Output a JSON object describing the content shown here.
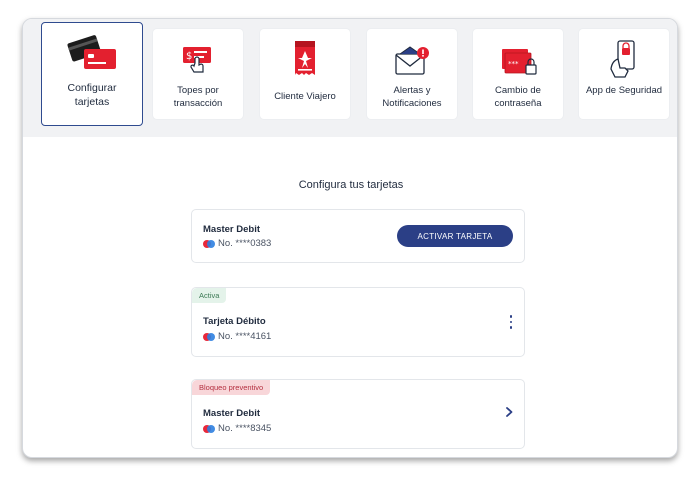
{
  "tiles": [
    {
      "label": "Configurar tarjetas",
      "icon": "credit-cards-icon",
      "active": true
    },
    {
      "label": "Topes por transacción",
      "icon": "transaction-limit-icon",
      "active": false
    },
    {
      "label": "Cliente Viajero",
      "icon": "traveler-ticket-icon",
      "active": false
    },
    {
      "label": "Alertas y Notificaciones",
      "icon": "alert-envelope-icon",
      "active": false
    },
    {
      "label": "Cambio de contraseña",
      "icon": "password-change-icon",
      "active": false
    },
    {
      "label": "App de Seguridad",
      "icon": "security-app-icon",
      "active": false
    }
  ],
  "heading": "Configura tus tarjetas",
  "cards": [
    {
      "name": "Master Debit",
      "number": "No. ****0383",
      "action": "ACTIVAR TARJETA",
      "badge": ""
    },
    {
      "name": "Tarjeta Débito",
      "number": "No. ****4161",
      "badge": "Activa"
    },
    {
      "name": "Master Debit",
      "number": "No. ****8345",
      "badge": "Bloqueo preventivo"
    }
  ],
  "colors": {
    "brand_blue": "#2b3f86",
    "brand_red": "#e3202f",
    "active_badge_bg": "#e4f3ea",
    "blocked_badge_bg": "#f8d6d9"
  }
}
